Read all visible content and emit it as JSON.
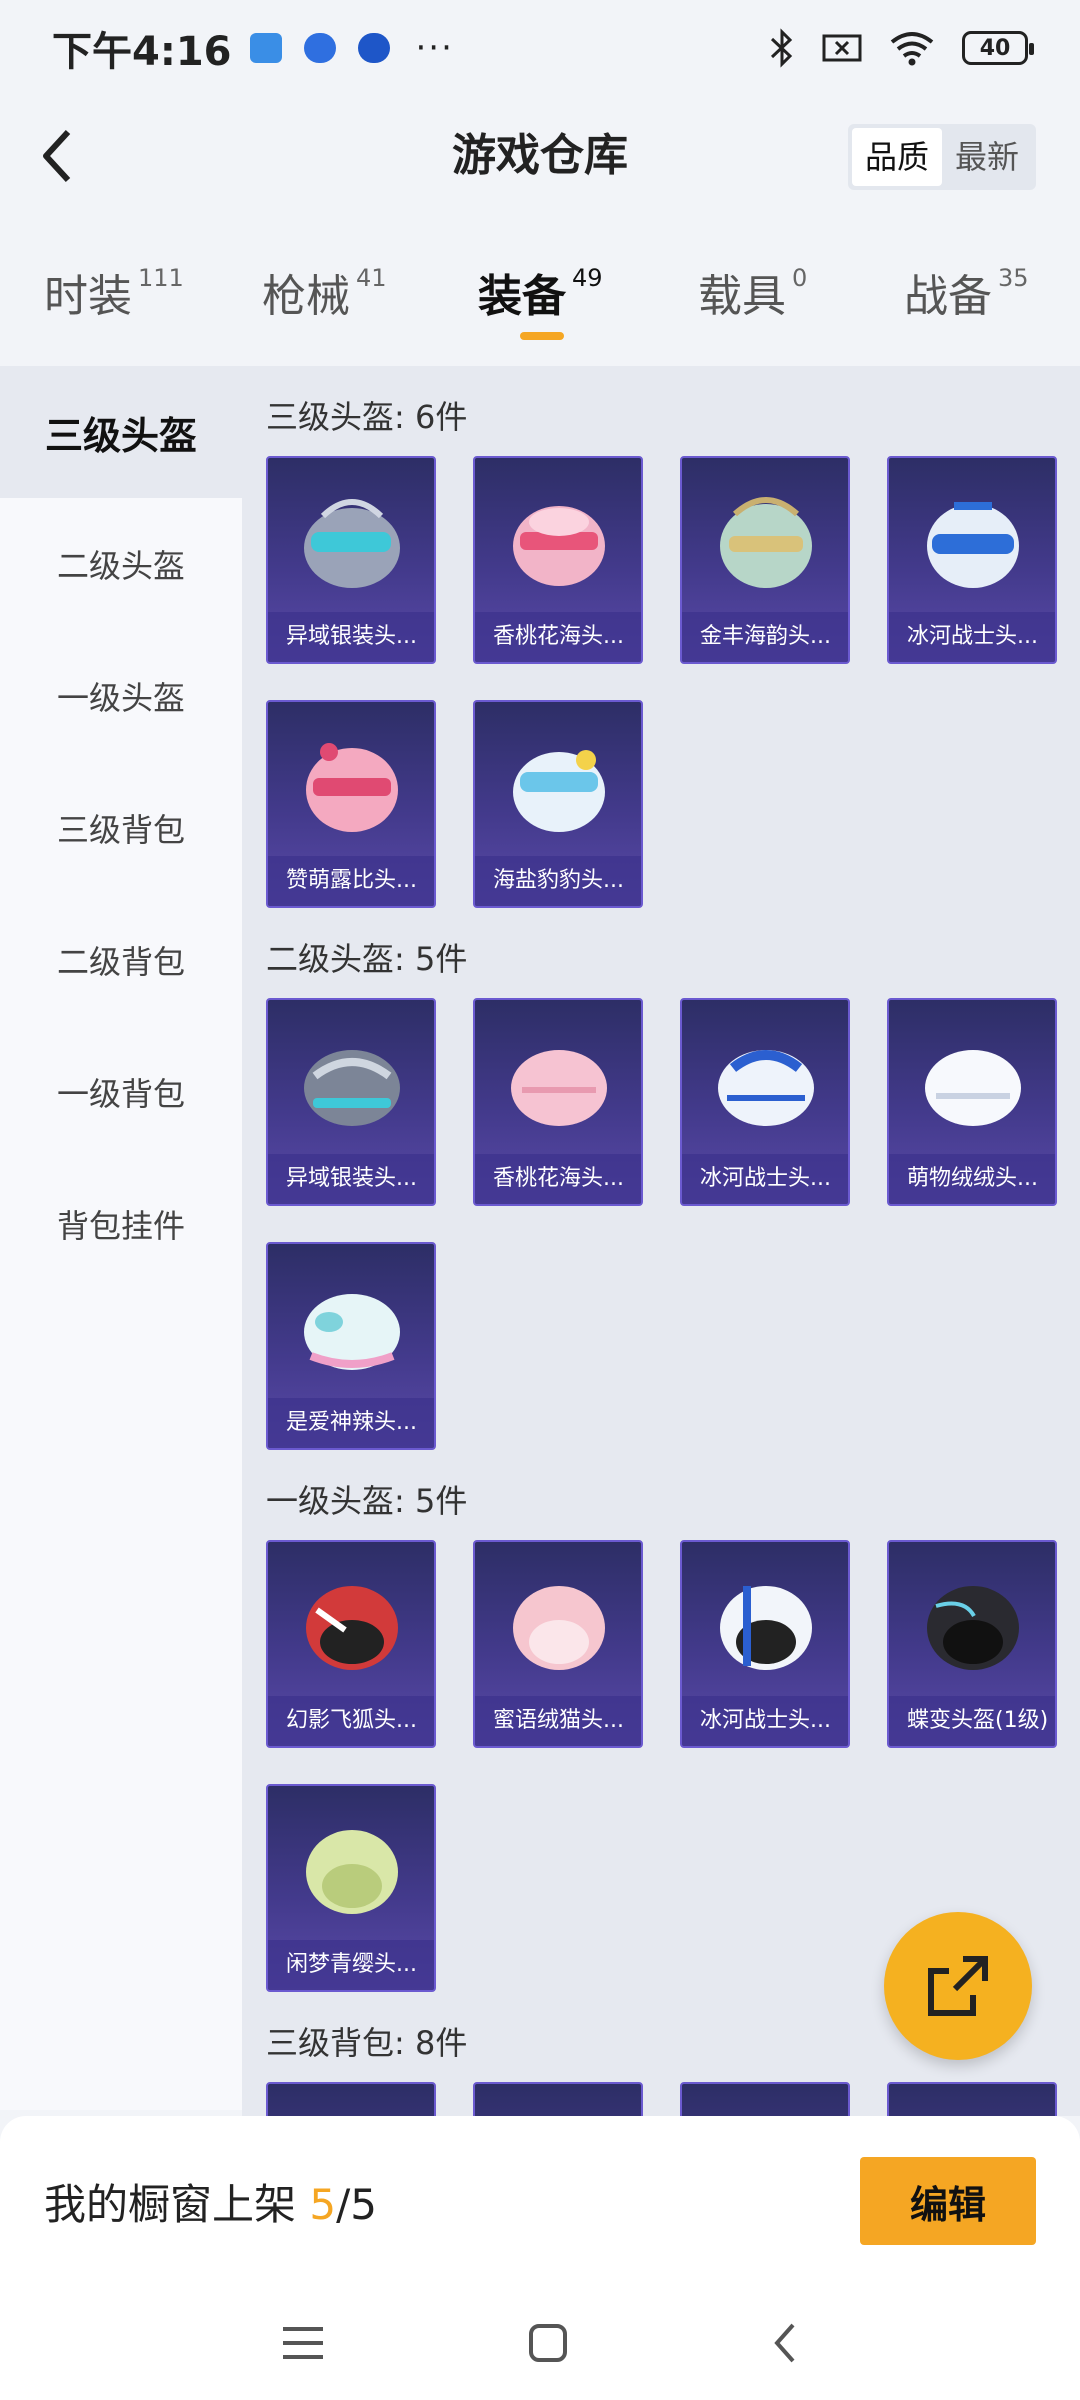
{
  "status": {
    "time": "下午4:16",
    "dots": "···",
    "battery": "40"
  },
  "header": {
    "title": "游戏仓库",
    "sort": [
      "品质",
      "最新"
    ],
    "sort_selected": "品质"
  },
  "tabs": [
    {
      "label": "时装",
      "count": "111"
    },
    {
      "label": "枪械",
      "count": "41"
    },
    {
      "label": "装备",
      "count": "49",
      "active": true
    },
    {
      "label": "载具",
      "count": "0"
    },
    {
      "label": "战备",
      "count": "35"
    }
  ],
  "sidebar": {
    "items": [
      "三级头盔",
      "二级头盔",
      "一级头盔",
      "三级背包",
      "二级背包",
      "一级背包",
      "背包挂件"
    ],
    "active": "三级头盔"
  },
  "sections": [
    {
      "title": "三级头盔: 6件",
      "items": [
        "异域银装头...",
        "香桃花海头...",
        "金丰海韵头...",
        "冰河战士头...",
        "赞萌露比头...",
        "海盐豹豹头..."
      ]
    },
    {
      "title": "二级头盔: 5件",
      "items": [
        "异域银装头...",
        "香桃花海头...",
        "冰河战士头...",
        "萌物绒绒头...",
        "是爱神辣头..."
      ]
    },
    {
      "title": "一级头盔: 5件",
      "items": [
        "幻影飞狐头...",
        "蜜语绒猫头...",
        "冰河战士头...",
        "蝶变头盔(1级)",
        "闲梦青缨头..."
      ]
    },
    {
      "title": "三级背包: 8件",
      "items": []
    }
  ],
  "bottom": {
    "shelf_label": "我的橱窗上架",
    "shelf_current": "5",
    "shelf_total": "/5",
    "edit_label": "编辑"
  },
  "colors": {
    "accent": "#f5a623",
    "card": "#433a8c"
  }
}
